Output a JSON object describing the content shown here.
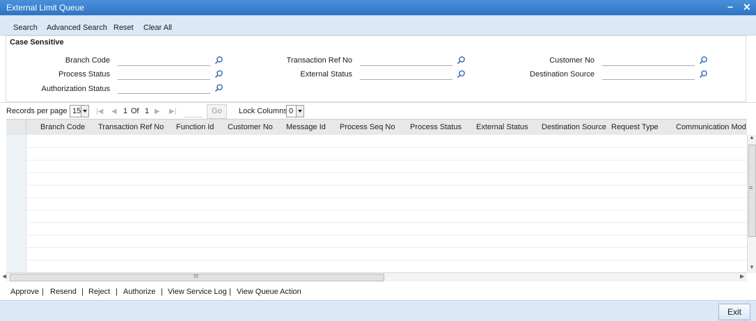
{
  "window": {
    "title": "External Limit Queue",
    "minimize": "−",
    "close": "✕"
  },
  "toolbar": {
    "search": "Search",
    "advanced_search": "Advanced Search",
    "reset": "Reset",
    "clear_all": "Clear All"
  },
  "criteria": {
    "legend": "Case Sensitive",
    "fields": {
      "branch_code": {
        "label": "Branch Code",
        "value": ""
      },
      "process_status": {
        "label": "Process Status",
        "value": ""
      },
      "authorization_status": {
        "label": "Authorization Status",
        "value": ""
      },
      "transaction_ref_no": {
        "label": "Transaction Ref No",
        "value": ""
      },
      "external_status": {
        "label": "External Status",
        "value": ""
      },
      "customer_no": {
        "label": "Customer No",
        "value": ""
      },
      "destination_source": {
        "label": "Destination Source",
        "value": ""
      }
    }
  },
  "pager": {
    "records_label": "Records per page",
    "records_value": "15",
    "current_page": "1",
    "of_label": "Of",
    "total_pages": "1",
    "go_label": "Go",
    "lock_label": "Lock Columns",
    "lock_value": "0"
  },
  "grid": {
    "headers": [
      "Branch Code",
      "Transaction Ref No",
      "Function Id",
      "Customer No",
      "Message Id",
      "Process Seq No",
      "Process Status",
      "External Status",
      "Destination Source",
      "Request Type",
      "Communication Mod"
    ],
    "row_count": 11,
    "hscroll_grip": "III",
    "vscroll_grip": "≡"
  },
  "actions": [
    "Approve",
    "Resend",
    "Reject",
    "Authorize",
    "View Service Log",
    "View Queue Action"
  ],
  "separator": "|",
  "footer": {
    "exit": "Exit"
  },
  "icons": {
    "lookup": "search-icon"
  },
  "colors": {
    "title_bar": "#2f74c4",
    "toolbar_bg": "#dbe8f6",
    "lookup_icon": "#3a73b5"
  }
}
